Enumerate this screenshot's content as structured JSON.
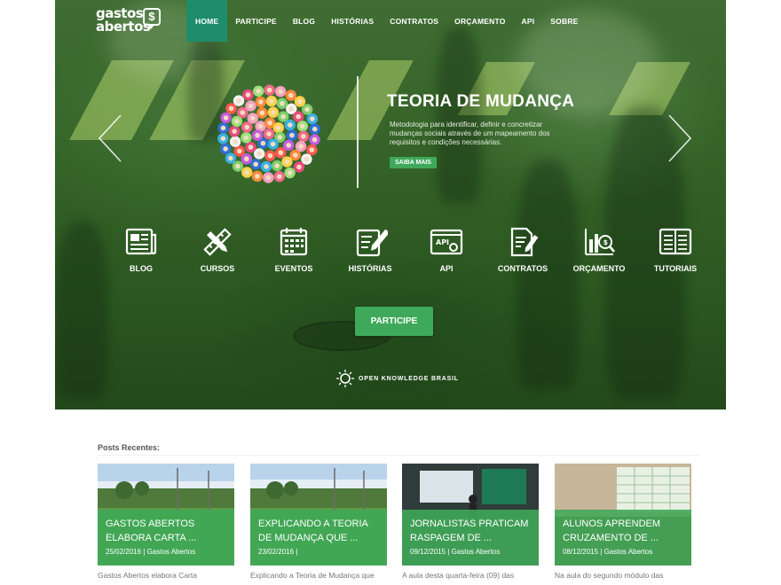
{
  "logo": {
    "line1": "gastos",
    "line2": "abertos",
    "symbol": "$"
  },
  "nav": {
    "items": [
      {
        "label": "HOME",
        "active": true
      },
      {
        "label": "PARTICIPE",
        "active": false
      },
      {
        "label": "BLOG",
        "active": false
      },
      {
        "label": "HISTÓRIAS",
        "active": false
      },
      {
        "label": "CONTRATOS",
        "active": false
      },
      {
        "label": "ORÇAMENTO",
        "active": false
      },
      {
        "label": "API",
        "active": false
      },
      {
        "label": "SOBRE",
        "active": false
      }
    ]
  },
  "slider": {
    "title": "TEORIA DE  MUDANÇA",
    "description": "Metodologia para identificar, definir e concretizar mudanças sociais através de um mapeamento dos requisitos e condições necessárias.",
    "button": "SAIBA MAIS",
    "prev_icon": "chevron-left-icon",
    "next_icon": "chevron-right-icon"
  },
  "categories": [
    {
      "label": "BLOG",
      "icon": "newspaper-icon"
    },
    {
      "label": "CURSOS",
      "icon": "ruler-pencil-icon"
    },
    {
      "label": "EVENTOS",
      "icon": "calendar-icon"
    },
    {
      "label": "HISTÓRIAS",
      "icon": "notepad-icon"
    },
    {
      "label": "API",
      "icon": "api-window-icon"
    },
    {
      "label": "CONTRATOS",
      "icon": "contract-icon"
    },
    {
      "label": "ORÇAMENTO",
      "icon": "budget-chart-icon"
    },
    {
      "label": "TUTORIAIS",
      "icon": "open-book-icon"
    }
  ],
  "cta": {
    "label": "PARTICIPE"
  },
  "okbr": {
    "label": "OPEN KNOWLEDGE BRASIL"
  },
  "posts": {
    "heading": "Posts Recentes:",
    "items": [
      {
        "title": "GASTOS ABERTOS ELABORA CARTA ...",
        "meta": "25/02/2016 | Gastos Abertos",
        "excerpt": "Gastos Abertos elabora Carta"
      },
      {
        "title": "EXPLICANDO A TEORIA DE MUDANÇA QUE ...",
        "meta": "23/02/2016 |",
        "excerpt": "Explicando a Teoria de Mudança que"
      },
      {
        "title": "JORNALISTAS PRATICAM RASPAGEM DE ...",
        "meta": "09/12/2015 | Gastos Abertos",
        "excerpt": "A aula desta quarta-feira (09) das"
      },
      {
        "title": "ALUNOS APRENDEM CRUZAMENTO DE ...",
        "meta": "08/12/2015 | Gastos Abertos",
        "excerpt": "Na aula do segundo módulo das"
      }
    ]
  },
  "colors": {
    "accent": "#3fa95b",
    "nav_active": "#1e8d6a",
    "hero_green": "#356328"
  }
}
